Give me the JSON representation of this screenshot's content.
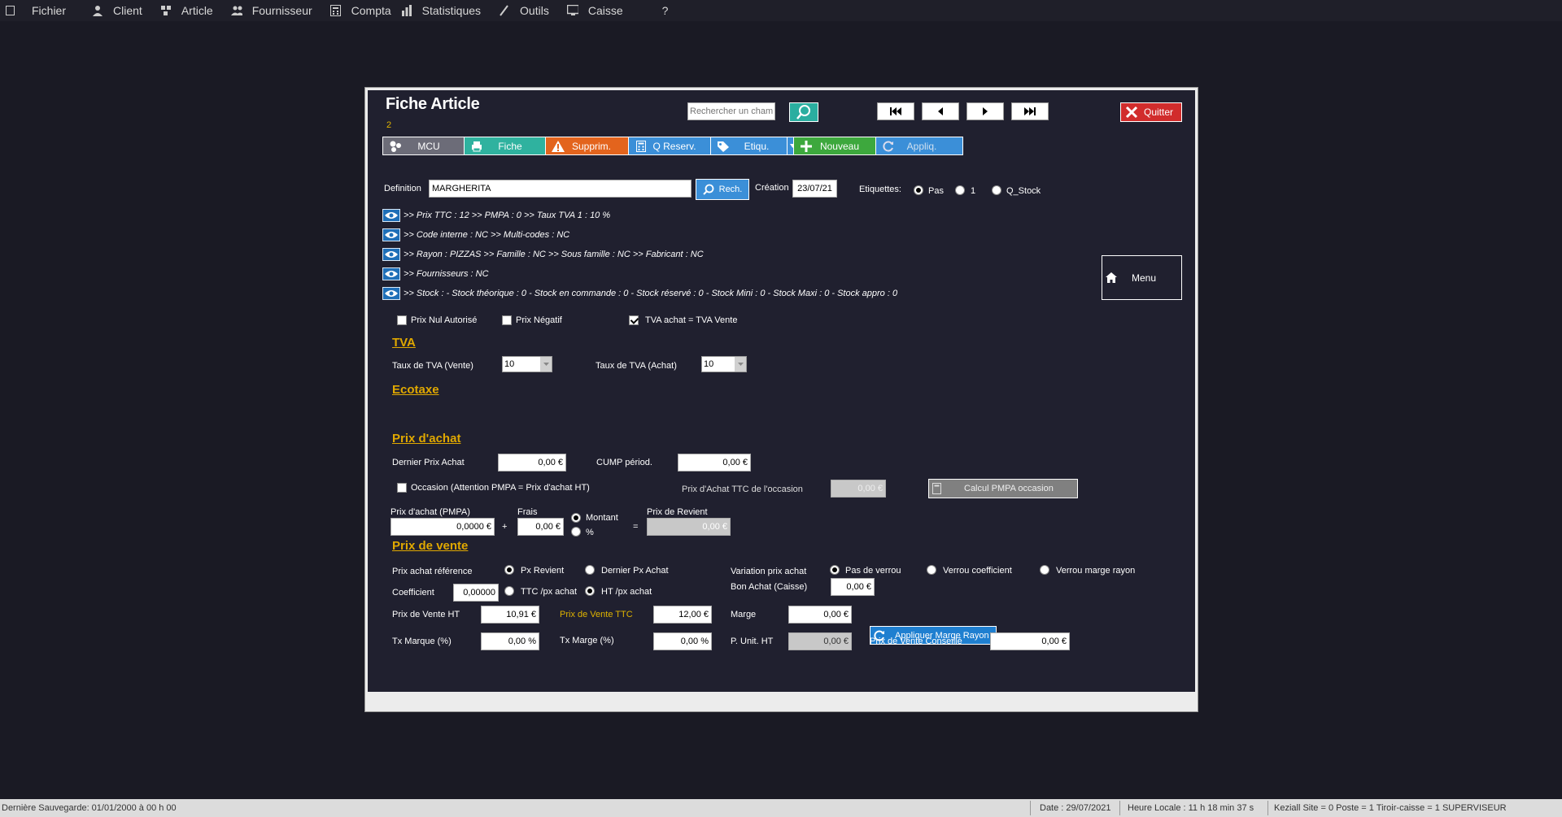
{
  "menu": {
    "items": [
      "Fichier",
      "Client",
      "Article",
      "Fournisseur",
      "Compta",
      "Statistiques",
      "Outils",
      "Caisse",
      "?"
    ]
  },
  "dialog": {
    "title": "Fiche Article",
    "id": "2",
    "search_placeholder": "Rechercher un champ...",
    "quit_label": "Quitter",
    "toolbar": {
      "mcu": "MCU",
      "fiche": "Fiche",
      "supprim": "Supprim.",
      "qreserv": "Q Reserv.",
      "etiqu": "Etiqu.",
      "nouveau": "Nouveau",
      "appliq": "Appliq."
    },
    "definition_label": "Definition",
    "definition_value": "MARGHERITA",
    "rech_label": "Rech.",
    "creation_label": "Création",
    "creation_value": "23/07/21",
    "etiquettes_label": "Etiquettes:",
    "etiquettes_options": [
      "Pas",
      "1",
      "Q_Stock"
    ],
    "info_lines": [
      ">> Prix TTC : 12 >> PMPA : 0 >> Taux TVA 1 : 10 %",
      ">> Code interne : NC >> Multi-codes : NC",
      ">> Rayon : PIZZAS >> Famille : NC >> Sous famille : NC >> Fabricant : NC",
      ">> Fournisseurs : NC",
      ">> Stock : - Stock théorique : 0 - Stock en commande : 0 - Stock réservé : 0 - Stock Mini : 0 - Stock Maxi : 0 - Stock appro : 0"
    ],
    "menu_label": "Menu",
    "checks": {
      "prix_nul": "Prix Nul Autorisé",
      "prix_negatif": "Prix Négatif",
      "tva_achat": "TVA achat = TVA Vente"
    },
    "tva": {
      "heading": "TVA",
      "vente_label": "Taux de TVA (Vente)",
      "vente_value": "10",
      "achat_label": "Taux de TVA (Achat)",
      "achat_value": "10"
    },
    "ecotaxe_heading": "Ecotaxe",
    "achat": {
      "heading": "Prix d'achat",
      "dernier_label": "Dernier Prix Achat",
      "dernier_value": "0,00 €",
      "cump_label": "CUMP périod.",
      "cump_value": "0,00 €",
      "occasion_label": "Occasion (Attention PMPA = Prix d'achat HT)",
      "ttc_occasion_label": "Prix d'Achat TTC de l'occasion",
      "ttc_occasion_value": "0,00 €",
      "calc_label": "Calcul PMPA occasion",
      "pmpa_label": "Prix d'achat (PMPA)",
      "pmpa_value": "0,0000 €",
      "plus": "+",
      "frais_label": "Frais",
      "frais_value": "0,00 €",
      "montant_label": "Montant",
      "pct_label": "%",
      "equals": "=",
      "revient_label": "Prix de Revient",
      "revient_value": "0,00 €"
    },
    "vente": {
      "heading": "Prix de vente",
      "ref_label": "Prix achat référence",
      "px_revient": "Px Revient",
      "dernier_px": "Dernier Px Achat",
      "variation_label": "Variation prix achat",
      "pas_verrou": "Pas de verrou",
      "verrou_coef": "Verrou coefficient",
      "verrou_marge": "Verrou marge rayon",
      "coef_label": "Coefficient",
      "coef_value": "0,00000",
      "ttc_px": "TTC /px achat",
      "ht_px": "HT /px achat",
      "bon_achat_label": "Bon Achat (Caisse)",
      "bon_achat_value": "0,00 €",
      "pv_ht_label": "Prix de Vente HT",
      "pv_ht_value": "10,91 €",
      "pv_ttc_label": "Prix de Vente TTC",
      "pv_ttc_value": "12,00 €",
      "marge_label": "Marge",
      "marge_value": "0,00 €",
      "apply_label": "Appliquer Marge Rayon",
      "tx_marque_label": "Tx Marque (%)",
      "tx_marque_value": "0,00 %",
      "tx_marge_label": "Tx Marge (%)",
      "tx_marge_value": "0,00 %",
      "punit_label": "P. Unit. HT",
      "punit_value": "0,00 €",
      "conseille_label": "Prix de Vente Conseillé",
      "conseille_value": "0,00 €"
    }
  },
  "status": {
    "last_save": "Dernière Sauvegarde: 01/01/2000 à 00 h 00",
    "date": "Date : 29/07/2021",
    "time": "Heure Locale : 11 h 18 min 37 s",
    "session": "Keziall  Site = 0  Poste = 1  Tiroir-caisse = 1 SUPERVISEUR"
  },
  "colors": {
    "background": "#1a1a24",
    "panel": "#20202f",
    "section_heading": "#e0a800",
    "danger": "#d12c2c",
    "teal": "#2aaea0",
    "blue": "#3b8fd8"
  }
}
